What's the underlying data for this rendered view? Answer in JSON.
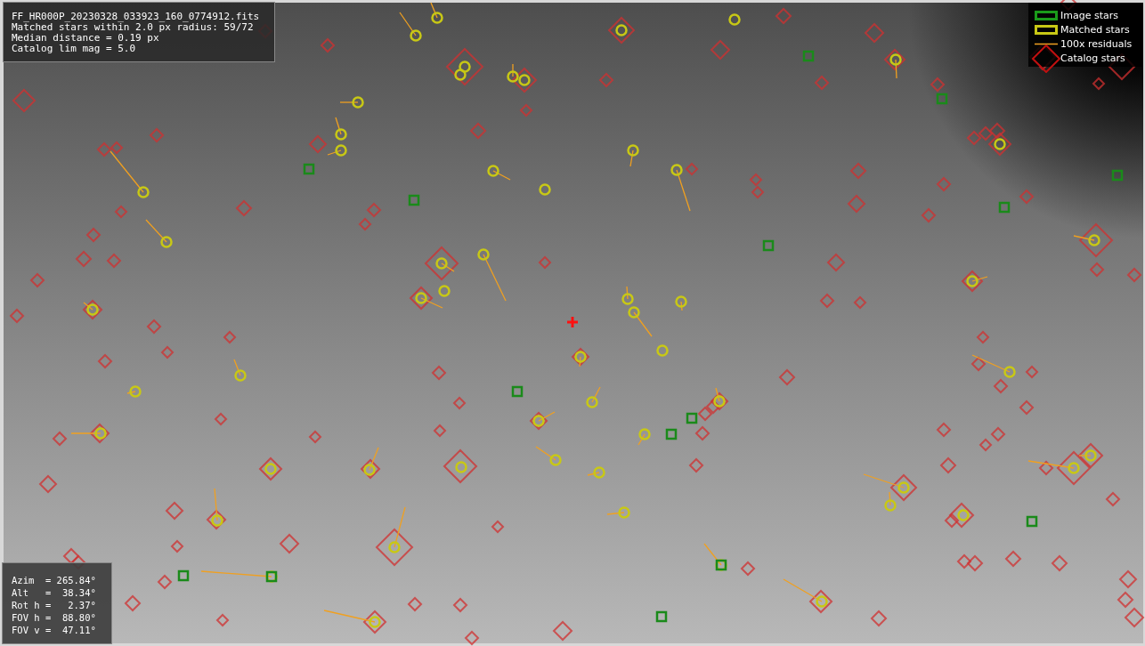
{
  "info": {
    "lines": [
      "FF_HR000P_20230328_033923_160_0774912.fits",
      "Matched stars within 2.0 px radius: 59/72",
      "Median distance = 0.19 px",
      "Catalog lim mag = 5.0"
    ]
  },
  "legend": [
    {
      "kind": "image",
      "label": "Image stars"
    },
    {
      "kind": "matched",
      "label": "Matched stars"
    },
    {
      "kind": "residual",
      "label": "100x residuals"
    },
    {
      "kind": "catalog",
      "label": "Catalog stars"
    }
  ],
  "pointing": {
    "lines": [
      "Azim  = 265.84°",
      "Alt   =  38.34°",
      "Rot h =   2.37°",
      "FOV h =  88.80°",
      "FOV v =  47.11°"
    ]
  }
}
